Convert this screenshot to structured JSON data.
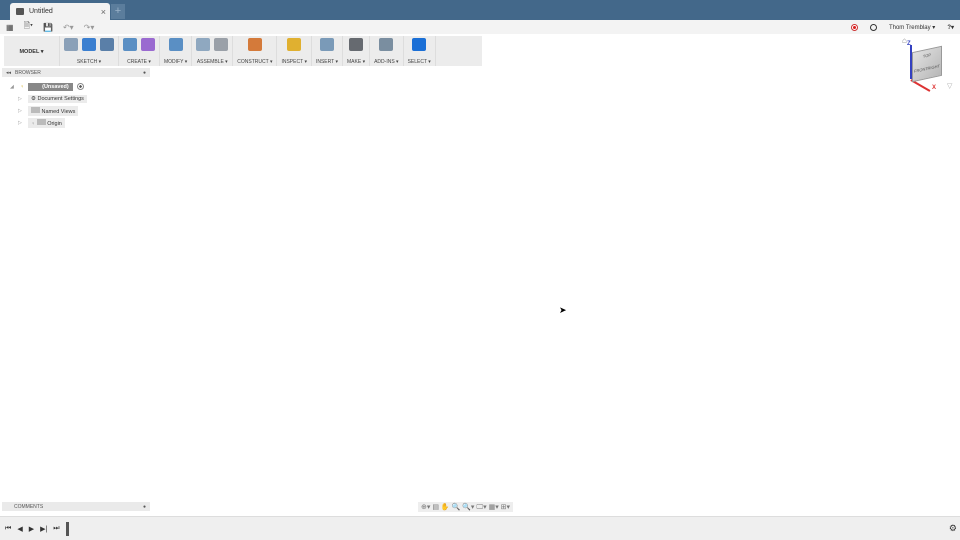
{
  "tab": {
    "title": "Untitled",
    "close": "×",
    "new": "+"
  },
  "qat": {
    "grid": "▦",
    "file": "🗎▾",
    "save": "💾",
    "undo": "↶▾",
    "redo": "↷▾"
  },
  "user": {
    "name": "Thom Tremblay ▾",
    "help": "?▾"
  },
  "ribbon": {
    "workspace": "MODEL ▾",
    "groups": [
      {
        "label": "SKETCH ▾",
        "colors": [
          "#8aa0b8",
          "#3b7fd0",
          "#5a7fa8"
        ]
      },
      {
        "label": "CREATE ▾",
        "colors": [
          "#5a8fc4",
          "#9a6ad0"
        ]
      },
      {
        "label": "MODIFY ▾",
        "colors": [
          "#5a8fc4"
        ]
      },
      {
        "label": "ASSEMBLE ▾",
        "colors": [
          "#8fa8c0",
          "#9aa0a8"
        ]
      },
      {
        "label": "CONSTRUCT ▾",
        "colors": [
          "#d47a3a"
        ]
      },
      {
        "label": "INSPECT ▾",
        "colors": [
          "#e0b030"
        ]
      },
      {
        "label": "INSERT ▾",
        "colors": [
          "#7a9ab8"
        ]
      },
      {
        "label": "MAKE ▾",
        "colors": [
          "#666a70"
        ]
      },
      {
        "label": "ADD-INS ▾",
        "colors": [
          "#7a8ea0"
        ]
      },
      {
        "label": "SELECT ▾",
        "colors": [
          "#1a6fd6"
        ]
      }
    ]
  },
  "browser": {
    "title": "BROWSER",
    "root": "(Unsaved)",
    "items": [
      "Document Settings",
      "Named Views",
      "Origin"
    ]
  },
  "comments": {
    "title": "COMMENTS"
  },
  "viewcube": {
    "top": "TOP",
    "front": "FRONT",
    "right": "RIGHT",
    "z": "Z",
    "x": "X"
  },
  "navbar": {
    "icons": "⊕▾ ▤ ✋ 🔍 🔍▾ 🖵▾ ▦▾ ⊞▾"
  },
  "timeline": {
    "controls": [
      "⏮",
      "◀",
      "▶",
      "▶|",
      "⏭"
    ],
    "settings": "⚙"
  }
}
